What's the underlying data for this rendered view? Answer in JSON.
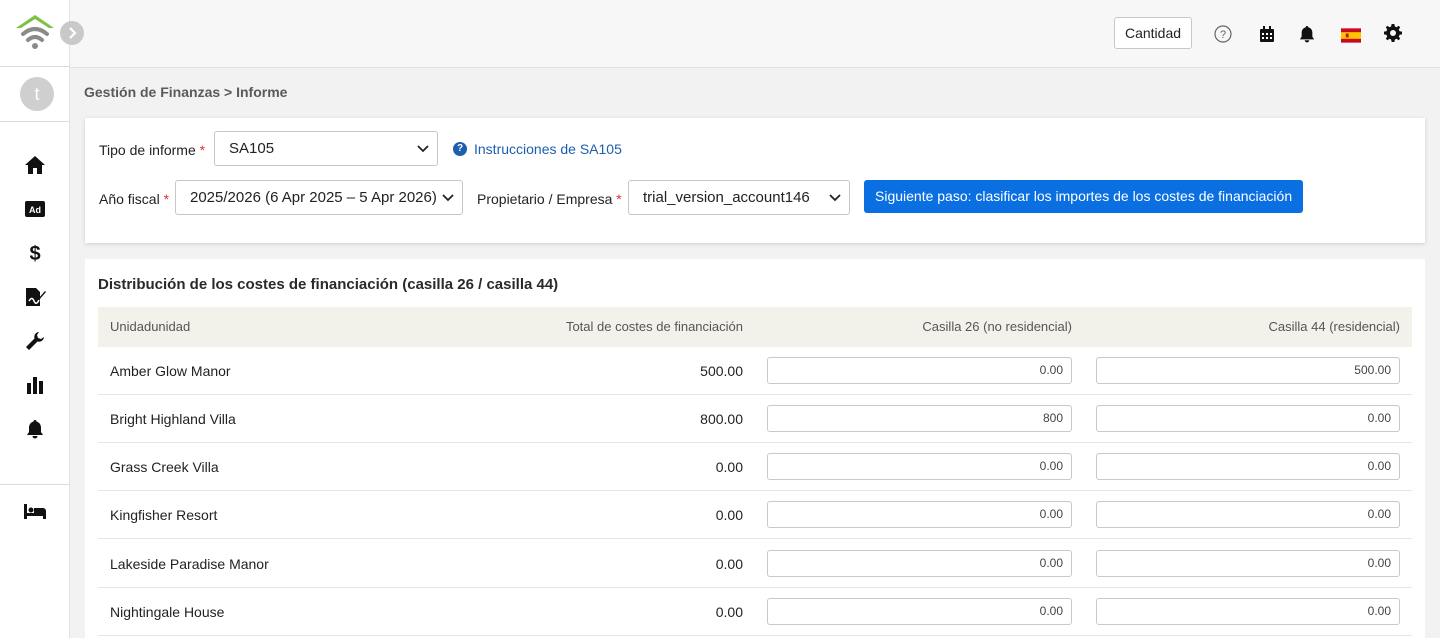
{
  "header": {
    "cantidad_label": "Cantidad",
    "icons": [
      "help-icon",
      "calendar-icon",
      "bell-icon",
      "spain-flag-icon",
      "gear-icon"
    ]
  },
  "sidebar": {
    "avatar_letter": "t",
    "items": [
      "home-icon",
      "ad-icon",
      "dollar-icon",
      "signature-icon",
      "wrench-icon",
      "bar-chart-icon",
      "bell-icon",
      "bed-icon"
    ]
  },
  "breadcrumb": "Gestión de Finanzas > Informe",
  "filters": {
    "tipo_label": "Tipo de informe",
    "tipo_value": "SA105",
    "instrucciones": "Instrucciones de SA105",
    "anio_label": "Año fiscal",
    "anio_value": "2025/2026 (6 Apr 2025 – 5 Apr 2026)",
    "propietario_label": "Propietario / Empresa",
    "propietario_value": "trial_version_account146",
    "next_button": "Siguiente paso: clasificar los importes de los costes de financiación"
  },
  "table": {
    "title": "Distribución de los costes de financiación (casilla 26 / casilla 44)",
    "headers": {
      "unidad": "Unidadunidad",
      "total": "Total de costes de financiación",
      "casilla26": "Casilla 26 (no residencial)",
      "casilla44": "Casilla 44 (residencial)"
    },
    "rows": [
      {
        "name": "Amber Glow Manor",
        "total": "500.00",
        "c26": "0.00",
        "c44": "500.00"
      },
      {
        "name": "Bright Highland Villa",
        "total": "800.00",
        "c26": "800",
        "c44": "0.00"
      },
      {
        "name": "Grass Creek Villa",
        "total": "0.00",
        "c26": "0.00",
        "c44": "0.00"
      },
      {
        "name": "Kingfisher Resort",
        "total": "0.00",
        "c26": "0.00",
        "c44": "0.00"
      },
      {
        "name": "Lakeside Paradise Manor",
        "total": "0.00",
        "c26": "0.00",
        "c44": "0.00"
      },
      {
        "name": "Nightingale House",
        "total": "0.00",
        "c26": "0.00",
        "c44": "0.00"
      }
    ]
  },
  "colors": {
    "accent": "#0a6fe0",
    "link": "#1d5fae",
    "logo_green": "#7cc242",
    "table_header_bg": "#f3f2ea"
  }
}
